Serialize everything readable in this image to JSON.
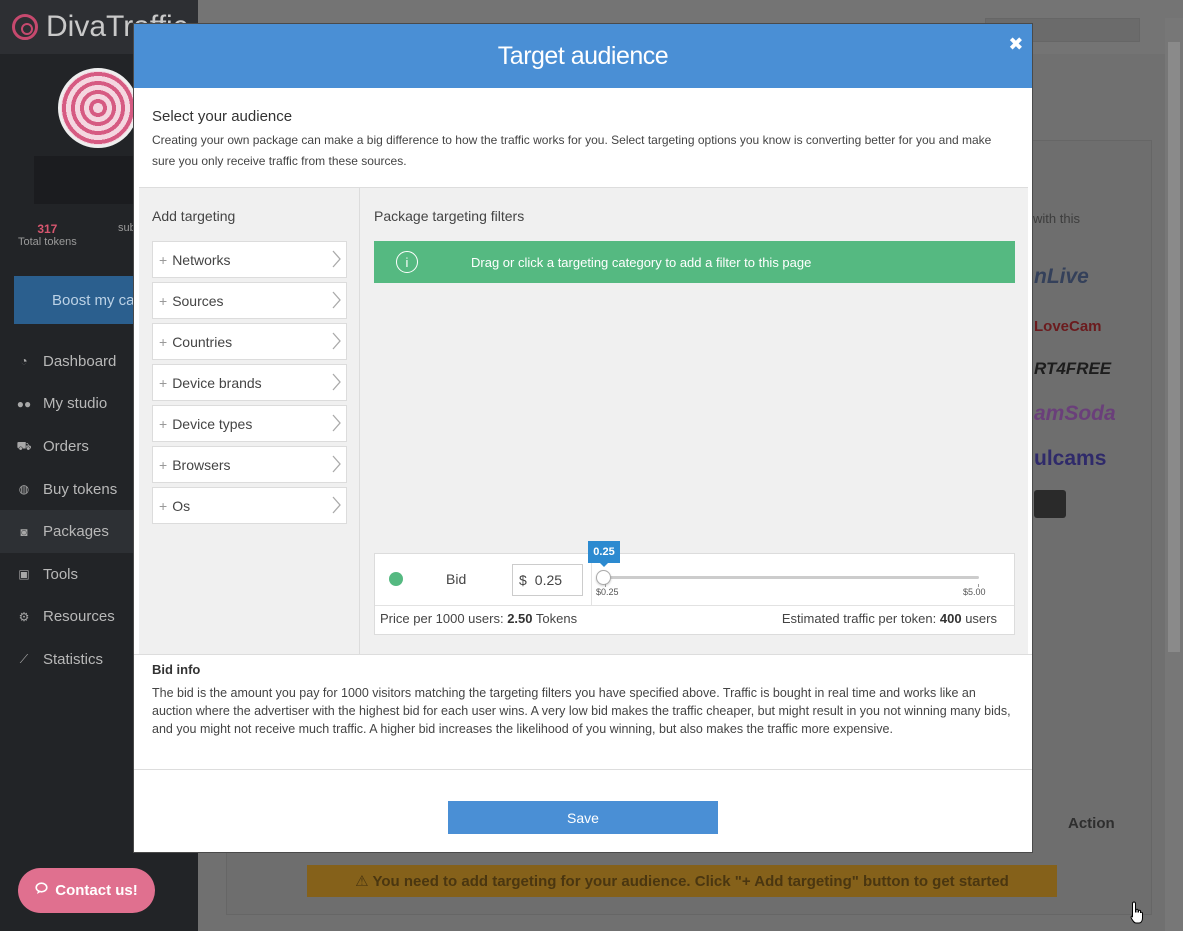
{
  "app": {
    "brand": "DivaTraffic",
    "stats": [
      {
        "value": "317",
        "label": "Total tokens"
      },
      {
        "value": "",
        "label": "sub"
      }
    ],
    "boost_label": "Boost my ca",
    "nav": [
      {
        "label": "Dashboard",
        "icon": "dashboard-icon"
      },
      {
        "label": "My studio",
        "icon": "users-icon"
      },
      {
        "label": "Orders",
        "icon": "cart-icon"
      },
      {
        "label": "Buy tokens",
        "icon": "globe-icon"
      },
      {
        "label": "Packages",
        "icon": "car-icon"
      },
      {
        "label": "Tools",
        "icon": "toolbox-icon"
      },
      {
        "label": "Resources",
        "icon": "gears-icon"
      },
      {
        "label": "Statistics",
        "icon": "chart-icon"
      }
    ],
    "right_note": "with this",
    "logos": [
      "nLive",
      "LoveCam",
      "RT4FREE",
      "amSoda",
      "ulcams"
    ],
    "table_action_header": "Action",
    "warning": "⚠ You need to add targeting for your audience. Click \"+ Add targeting\" button to get started",
    "contact_label": "Contact us!"
  },
  "modal": {
    "title": "Target audience",
    "intro_title": "Select your audience",
    "intro_text": "Creating your own package can make a big difference to how the traffic works for you. Select targeting options you know is converting better for you and make sure you only receive traffic from these sources.",
    "add_targeting_title": "Add targeting",
    "categories": [
      "Networks",
      "Sources",
      "Countries",
      "Device brands",
      "Device types",
      "Browsers",
      "Os"
    ],
    "filters_title": "Package targeting filters",
    "info_message": "Drag or click a targeting category to add a filter to this page",
    "bid": {
      "label": "Bid",
      "currency": "$",
      "value": "0.25",
      "tooltip": "0.25",
      "min_label": "$0.25",
      "max_label": "$5.00",
      "min": 0.25,
      "max": 5.0,
      "current": 0.25
    },
    "price_label": "Price per 1000 users:",
    "price_value": "2.50",
    "price_unit": "Tokens",
    "estimate_label": "Estimated traffic per token:",
    "estimate_value": "400",
    "estimate_unit": "users",
    "bid_info_title": "Bid info",
    "bid_info_text": "The bid is the amount you pay for 1000 visitors matching the targeting filters you have specified above. Traffic is bought in real time and works like an auction where the advertiser with the highest bid for each user wins. A very low bid makes the traffic cheaper, but might result in you not winning many bids, and you might not receive much traffic. A higher bid increases the likelihood of you winning, but also makes the traffic more expensive.",
    "save_label": "Save"
  },
  "colors": {
    "accent": "#4a8fd5",
    "success": "#55b981",
    "brand_pink": "#e0708f"
  }
}
